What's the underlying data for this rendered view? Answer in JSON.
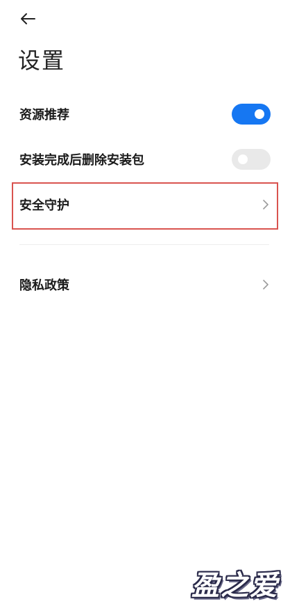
{
  "header": {
    "back_icon": "arrow-left-icon",
    "title": "设置"
  },
  "settings": {
    "resource_recommend": {
      "label": "资源推荐",
      "toggle": true
    },
    "delete_package": {
      "label": "安装完成后删除安装包",
      "toggle": false
    },
    "security": {
      "label": "安全守护",
      "icon": "chevron-right-icon"
    },
    "privacy": {
      "label": "隐私政策",
      "icon": "chevron-right-icon"
    }
  },
  "watermark": {
    "text": "盈之爱"
  },
  "colors": {
    "accent": "#1677f2",
    "toggle_off": "#e9e9e9",
    "highlight_border": "#d9534f"
  }
}
